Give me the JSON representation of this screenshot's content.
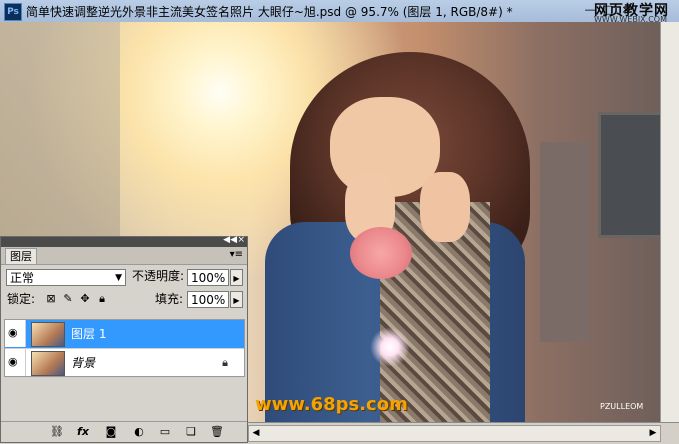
{
  "window": {
    "app_icon": "Ps",
    "title": "简单快速调整逆光外景非主流美女签名照片 大眼仔~旭.psd @ 95.7% (图层 1, RGB/8#) *",
    "buttons": {
      "minimize": "—",
      "maximize": "□",
      "close": "×"
    }
  },
  "watermarks": {
    "top_right": "网页教学网",
    "top_right_url": "WWW.WEBJX.COM",
    "bottom_center": "www.68ps.com",
    "bottom_right": "PZULLEOM"
  },
  "layers_panel": {
    "tab_label": "图层",
    "blend_mode": "正常",
    "opacity_label": "不透明度:",
    "opacity_value": "100%",
    "lock_label": "锁定:",
    "fill_label": "填充:",
    "fill_value": "100%",
    "layers": [
      {
        "name": "图层 1",
        "selected": true,
        "visible": true,
        "locked": false
      },
      {
        "name": "背景",
        "selected": false,
        "visible": true,
        "locked": true
      }
    ],
    "footer_icons": [
      "link-icon",
      "fx-icon",
      "mask-icon",
      "adjustment-icon",
      "group-icon",
      "new-layer-icon",
      "trash-icon"
    ]
  },
  "colors": {
    "title_bar": "#b9cde6",
    "selected_layer": "#3399ff",
    "watermark": "#f4a400"
  }
}
